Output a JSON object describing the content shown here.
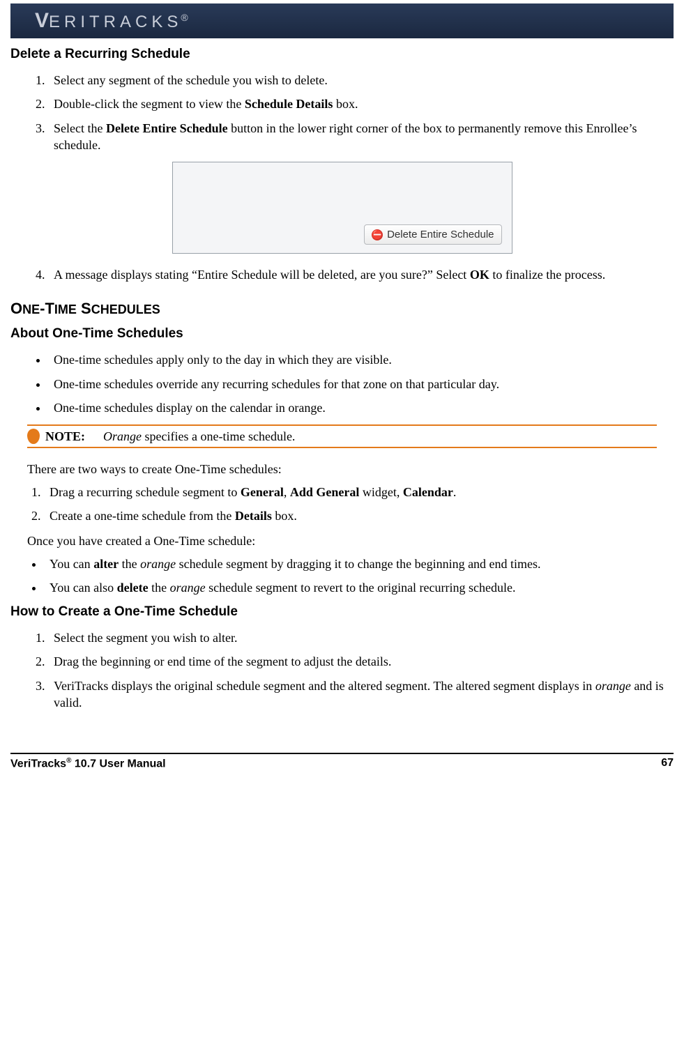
{
  "header": {
    "brand_prefix": "V",
    "brand_rest": "ERITRACKS",
    "brand_reg": "®"
  },
  "section1": {
    "title": "Delete a Recurring Schedule",
    "steps_a": [
      {
        "html": "Select any segment of the schedule you wish to delete."
      },
      {
        "html": "Double-click the segment to view the <b>Schedule Details</b> box."
      },
      {
        "html": "Select the <b>Delete Entire Schedule</b> button in the lower right corner of the box to permanently remove this Enrollee’s schedule."
      }
    ],
    "button_label": "Delete Entire Schedule",
    "steps_b_start": 4,
    "steps_b": [
      {
        "html": "A message displays stating “Entire Schedule will be deleted, are you sure?”  Select <b>OK</b> to finalize the process."
      }
    ]
  },
  "section2": {
    "heading": "One-Time Schedules",
    "sub1": {
      "title": "About One-Time Schedules",
      "bullets": [
        {
          "html": "One-time schedules apply only to the day in which they are visible."
        },
        {
          "html": "One-time schedules override any recurring schedules for that zone on that particular day."
        },
        {
          "html": "One-time schedules display on the calendar in orange."
        }
      ],
      "note_label": "NOTE:",
      "note_html": "<i>Orange</i> specifies a one-time schedule.",
      "intro2": "There are two ways to create One-Time schedules:",
      "ways": [
        {
          "html": "Drag a recurring schedule segment to <b>General</b>, <b>Add General</b> widget, <b>Calendar</b>."
        },
        {
          "html": "Create a one-time schedule from the <b>Details</b> box."
        }
      ],
      "intro3": "Once you have created a One-Time schedule:",
      "after_bullets": [
        {
          "html": "You can <b>alter</b> the <i>orange</i> schedule segment by dragging it to change the beginning and end times."
        },
        {
          "html": "You can also <b>delete</b> the <i>orange</i> schedule segment to revert to the original recurring schedule."
        }
      ]
    },
    "sub2": {
      "title": "How to Create a One-Time Schedule",
      "steps": [
        {
          "html": "Select the segment you wish to alter."
        },
        {
          "html": "Drag the beginning or end time of the segment to adjust the details."
        },
        {
          "html": "VeriTracks displays the original schedule segment and the altered segment.  The altered segment displays in <i>orange</i> and is valid."
        }
      ]
    }
  },
  "footer": {
    "left_prefix": "VeriTracks",
    "left_reg": "®",
    "left_suffix": " 10.7 User Manual",
    "right": "67"
  }
}
